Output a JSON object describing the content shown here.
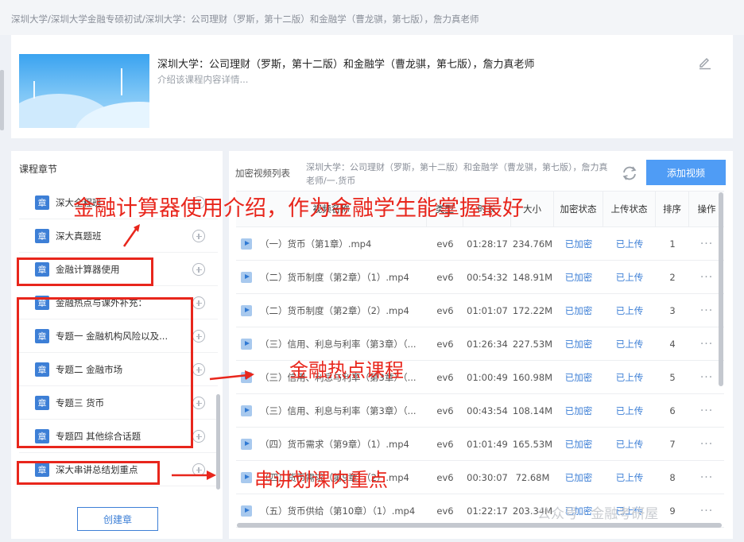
{
  "breadcrumb": "深圳大学/深圳大学金融专硕初试/深圳大学：公司理财（罗斯，第十二版）和金融学（曹龙骐，第七版），詹力真老师",
  "course": {
    "title": "深圳大学：公司理财（罗斯，第十二版）和金融学（曹龙骐，第七版），詹力真老师",
    "description": "介绍该课程内容详情..."
  },
  "chapters": {
    "title": "课程章节",
    "badge": "章",
    "items": [
      {
        "label": "深大全程班"
      },
      {
        "label": "深大真题班"
      },
      {
        "label": "金融计算器使用"
      },
      {
        "label": "金融热点与课外补充："
      },
      {
        "label": "专题一 金融机构风险以及..."
      },
      {
        "label": "专题二 金融市场"
      },
      {
        "label": "专题三 货币"
      },
      {
        "label": "专题四 其他综合话题"
      },
      {
        "label": "深大串讲总结划重点"
      }
    ],
    "create_button": "创建章"
  },
  "videos": {
    "title": "加密视频列表",
    "path": "深圳大学：公司理财（罗斯，第十二版）和金融学（曹龙骐，第七版），詹力真老师/一.货币",
    "add_button": "添加视频",
    "columns": [
      "视频名称",
      "类型",
      "时长",
      "大小",
      "加密状态",
      "上传状态",
      "排序",
      "操作"
    ],
    "rows": [
      {
        "name": "（一）货币（第1章）.mp4",
        "type": "ev6",
        "duration": "01:28:17",
        "size": "234.76M",
        "enc": "已加密",
        "upload": "已上传",
        "order": "1"
      },
      {
        "name": "（二）货币制度（第2章）（1）.mp4",
        "type": "ev6",
        "duration": "00:54:32",
        "size": "148.91M",
        "enc": "已加密",
        "upload": "已上传",
        "order": "2"
      },
      {
        "name": "（二）货币制度（第2章）（2）.mp4",
        "type": "ev6",
        "duration": "01:01:07",
        "size": "172.22M",
        "enc": "已加密",
        "upload": "已上传",
        "order": "3"
      },
      {
        "name": "（三）信用、利息与利率（第3章）（...",
        "type": "ev6",
        "duration": "01:26:34",
        "size": "227.53M",
        "enc": "已加密",
        "upload": "已上传",
        "order": "4"
      },
      {
        "name": "（三）信用、利息与利率（第3章）（...",
        "type": "ev6",
        "duration": "01:00:49",
        "size": "160.98M",
        "enc": "已加密",
        "upload": "已上传",
        "order": "5"
      },
      {
        "name": "（三）信用、利息与利率（第3章）（...",
        "type": "ev6",
        "duration": "00:43:54",
        "size": "108.14M",
        "enc": "已加密",
        "upload": "已上传",
        "order": "6"
      },
      {
        "name": "（四）货币需求（第9章）（1）.mp4",
        "type": "ev6",
        "duration": "01:01:49",
        "size": "165.53M",
        "enc": "已加密",
        "upload": "已上传",
        "order": "7"
      },
      {
        "name": "（四）货币需求（第9章）（2）.mp4",
        "type": "ev6",
        "duration": "00:30:07",
        "size": "72.68M",
        "enc": "已加密",
        "upload": "已上传",
        "order": "8"
      },
      {
        "name": "（五）货币供给（第10章）（1）.mp4",
        "type": "ev6",
        "duration": "01:22:17",
        "size": "203.34M",
        "enc": "已加密",
        "upload": "已上传",
        "order": "9"
      }
    ],
    "ops": "···"
  },
  "annotations": {
    "calculator": "金融计算器使用介绍，作为金融学生能掌握最好",
    "hot_topics": "金融热点课程",
    "review": "串讲划课内重点"
  },
  "watermark": "公众号 · 金融考研屋",
  "colors": {
    "accent": "#4f9cf5",
    "badge": "#3d7fd6",
    "annotation": "#e8261c"
  }
}
